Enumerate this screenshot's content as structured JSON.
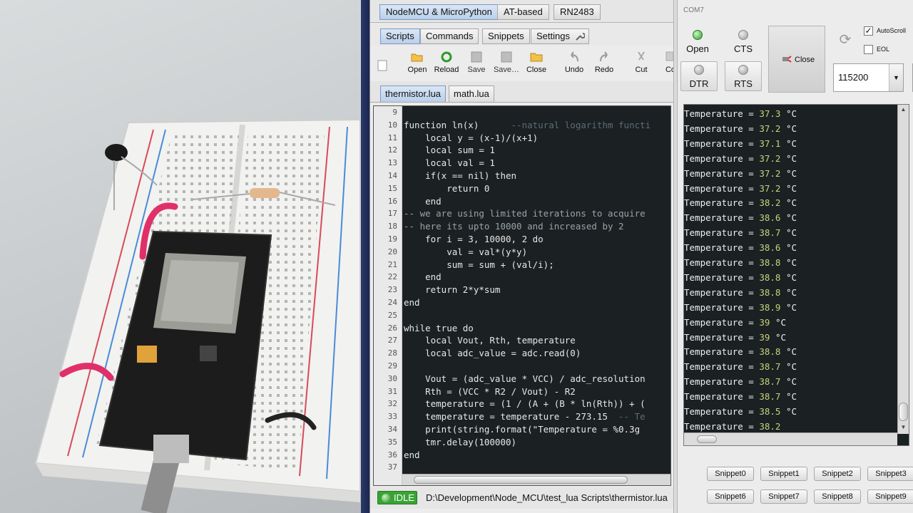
{
  "main_tabs": [
    "NodeMCU & MicroPython",
    "AT-based",
    "RN2483"
  ],
  "sub_tabs": [
    "Scripts",
    "Commands",
    "Snippets",
    "Settings"
  ],
  "toolbar": {
    "open": "Open",
    "reload": "Reload",
    "save": "Save",
    "save_as": "Save…",
    "close": "Close",
    "undo": "Undo",
    "redo": "Redo",
    "cut": "Cut",
    "copy": "Co"
  },
  "file_tabs": [
    "thermistor.lua",
    "math.lua"
  ],
  "code_lines": [
    {
      "n": "9",
      "t": ""
    },
    {
      "n": "10",
      "t": "function ln(x)      --natural logarithm functi"
    },
    {
      "n": "11",
      "t": "    local y = (x-1)/(x+1)"
    },
    {
      "n": "12",
      "t": "    local sum = 1"
    },
    {
      "n": "13",
      "t": "    local val = 1"
    },
    {
      "n": "14",
      "t": "    if(x == nil) then"
    },
    {
      "n": "15",
      "t": "        return 0"
    },
    {
      "n": "16",
      "t": "    end"
    },
    {
      "n": "17",
      "t": "-- we are using limited iterations to acquire"
    },
    {
      "n": "18",
      "t": "-- here its upto 10000 and increased by 2"
    },
    {
      "n": "19",
      "t": "    for i = 3, 10000, 2 do"
    },
    {
      "n": "20",
      "t": "        val = val*(y*y)"
    },
    {
      "n": "21",
      "t": "        sum = sum + (val/i);"
    },
    {
      "n": "22",
      "t": "    end"
    },
    {
      "n": "23",
      "t": "    return 2*y*sum"
    },
    {
      "n": "24",
      "t": "end"
    },
    {
      "n": "25",
      "t": ""
    },
    {
      "n": "26",
      "t": "while true do"
    },
    {
      "n": "27",
      "t": "    local Vout, Rth, temperature"
    },
    {
      "n": "28",
      "t": "    local adc_value = adc.read(0)"
    },
    {
      "n": "29",
      "t": ""
    },
    {
      "n": "30",
      "t": "    Vout = (adc_value * VCC) / adc_resolution"
    },
    {
      "n": "31",
      "t": "    Rth = (VCC * R2 / Vout) - R2"
    },
    {
      "n": "32",
      "t": "    temperature = (1 / (A + (B * ln(Rth)) + ("
    },
    {
      "n": "33",
      "t": "    temperature = temperature - 273.15  -- Te"
    },
    {
      "n": "34",
      "t": "    print(string.format(\"Temperature = %0.3g"
    },
    {
      "n": "35",
      "t": "    tmr.delay(100000)"
    },
    {
      "n": "36",
      "t": "end"
    },
    {
      "n": "37",
      "t": ""
    }
  ],
  "status": {
    "state": "IDLE",
    "path": "D:\\Development\\Node_MCU\\test_lua Scripts\\thermistor.lua"
  },
  "serial": {
    "port": "COM7",
    "open_label": "Open",
    "cts_label": "CTS",
    "dtr_label": "DTR",
    "rts_label": "RTS",
    "close_label": "Close",
    "autoscroll_label": "AutoScroll",
    "eol_label": "EOL",
    "baud": "115200"
  },
  "terminal": {
    "prefix": "Temperature = ",
    "unit": "°C",
    "readings": [
      "37.3",
      "37.2",
      "37.1",
      "37.2",
      "37.2",
      "37.2",
      "38.2",
      "38.6",
      "38.7",
      "38.6",
      "38.8",
      "38.8",
      "38.8",
      "38.9",
      "39",
      "39",
      "38.8",
      "38.7",
      "38.7",
      "38.7",
      "38.5",
      "38.2"
    ]
  },
  "snippets_row1": [
    "Snippet0",
    "Snippet1",
    "Snippet2",
    "Snippet3"
  ],
  "snippets_row2": [
    "Snippet6",
    "Snippet7",
    "Snippet8",
    "Snippet9"
  ],
  "colors": {
    "idle_green": "#3aa337",
    "editor_bg": "#1b2023",
    "active_tab": "#b9cfea"
  }
}
